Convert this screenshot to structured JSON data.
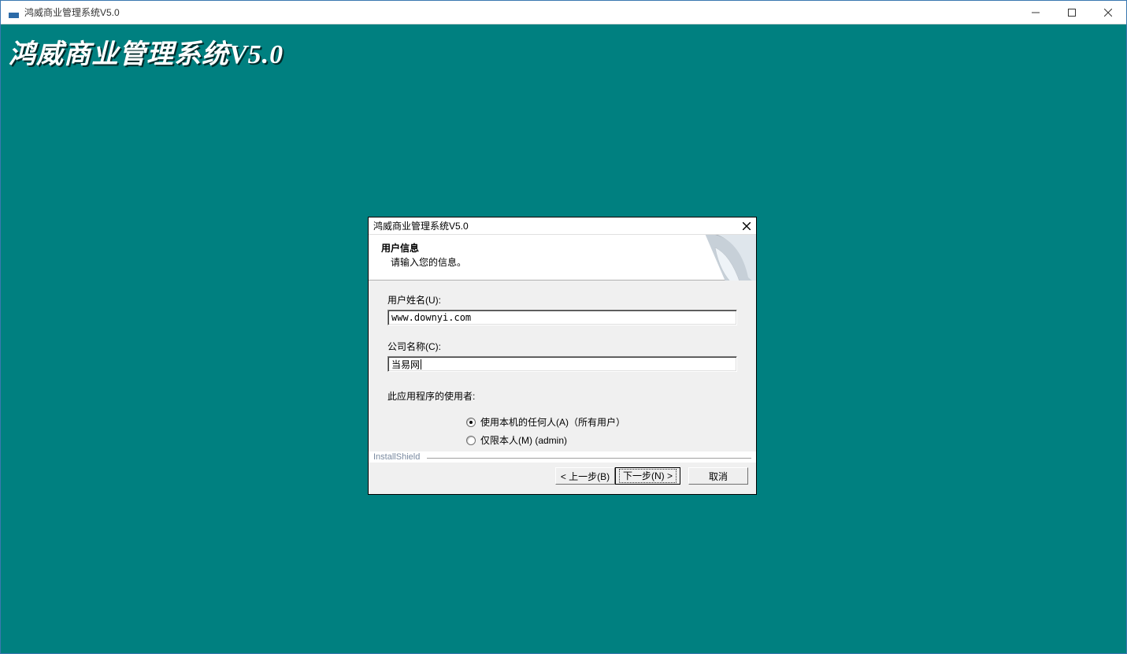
{
  "outerWindow": {
    "title": "鸿威商业管理系统V5.0"
  },
  "brandText": "鸿威商业管理系统V5.0",
  "installer": {
    "title": "鸿威商业管理系统V5.0",
    "header": {
      "title": "用户信息",
      "subtitle": "请输入您的信息。"
    },
    "fields": {
      "username_label": "用户姓名(U):",
      "username_value": "www.downyi.com",
      "company_label": "公司名称(C):",
      "company_value": "当易网"
    },
    "users_section_label": "此应用程序的使用者:",
    "radios": {
      "all_users": "使用本机的任何人(A)（所有用户）",
      "only_me": "仅限本人(M) (admin)"
    },
    "brand_small": "InstallShield",
    "buttons": {
      "back": "< 上一步(B)",
      "next": "下一步(N) >",
      "cancel": "取消"
    }
  }
}
